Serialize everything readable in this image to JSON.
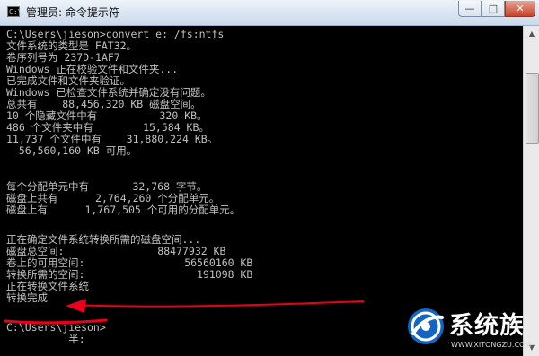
{
  "window": {
    "title": "管理员: 命令提示符",
    "icon": "cmd-icon",
    "icon_text": "C:\\",
    "controls": {
      "minimize": "—",
      "maximize": "□",
      "close": "✕"
    }
  },
  "console": {
    "lines": [
      "C:\\Users\\jieson>convert e: /fs:ntfs",
      "文件系统的类型是 FAT32。",
      "卷序列号为 237D-1AF7",
      "Windows 正在校验文件和文件夹...",
      "已完成文件和文件夹验证。",
      "Windows 已检查文件系统并确定没有问题。",
      "总共有    88,456,320 KB 磁盘空间。",
      "10 个隐藏文件中有          320 KB。",
      "486 个文件夹中有        15,584 KB。",
      "11,737 个文件中有    31,880,224 KB。",
      "  56,560,160 KB 可用。",
      "",
      "每个分配单元中有       32,768 字节。",
      "磁盘上共有      2,764,260 个分配单元。",
      "磁盘上有      1,767,505 个可用的分配单元。",
      "",
      "正在确定文件系统转换所需的磁盘空间...",
      "磁盘总空间:               88477932 KB",
      "卷上的可用空间:                56560160 KB",
      "转换所需的空间:                  191098 KB",
      "正在转换文件系统",
      "转换完成",
      "",
      "C:\\Users\\jieson>",
      "          半:"
    ]
  },
  "annotation": {
    "color": "#e8001c"
  },
  "watermark": {
    "name": "系统族",
    "url": "WWW.XITONGZU.COM",
    "logo": "xitongzu-logo"
  },
  "scrollbar": {
    "up": "▲",
    "down": "▼"
  }
}
